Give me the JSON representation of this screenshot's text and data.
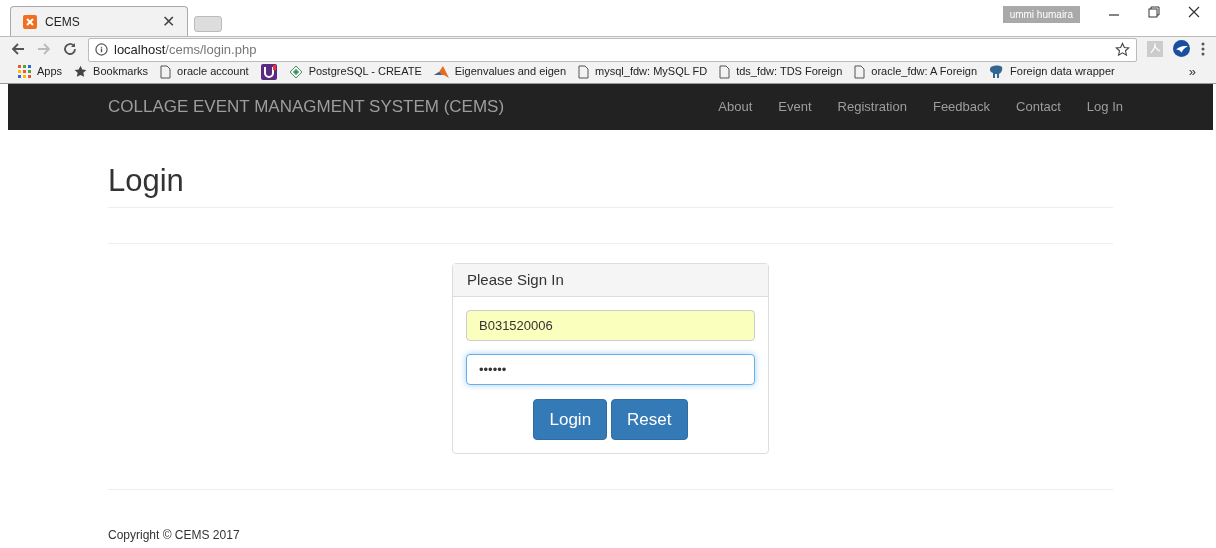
{
  "browser": {
    "tab": {
      "title": "CEMS",
      "close": "✕"
    },
    "profile": "ummi humaira",
    "address": {
      "host": "localhost",
      "path": "/cems/login.php"
    },
    "bookmarks": [
      {
        "label": "Apps",
        "kind": "apps"
      },
      {
        "label": "Bookmarks",
        "kind": "star"
      },
      {
        "label": "oracle account",
        "kind": "page"
      },
      {
        "kind": "u"
      },
      {
        "label": "PostgreSQL - CREATE",
        "kind": "diamond"
      },
      {
        "label": "Eigenvalues and eigen",
        "kind": "matlab"
      },
      {
        "label": "mysql_fdw: MySQL FD",
        "kind": "page"
      },
      {
        "label": "tds_fdw: TDS Foreign",
        "kind": "page"
      },
      {
        "label": "oracle_fdw: A Foreign",
        "kind": "page"
      },
      {
        "label": "Foreign data wrapper",
        "kind": "elephant"
      }
    ],
    "more": "»"
  },
  "navbar": {
    "brand": "COLLAGE EVENT MANAGMENT SYSTEM (CEMS)",
    "links": [
      "About",
      "Event",
      "Registration",
      "Feedback",
      "Contact",
      "Log In"
    ]
  },
  "page": {
    "heading": "Login",
    "panel": {
      "title": "Please Sign In",
      "username": "B031520006",
      "password": "••••••",
      "password_focused": true,
      "buttons": [
        "Login",
        "Reset"
      ]
    }
  },
  "footer": "Copyright © CEMS 2017"
}
